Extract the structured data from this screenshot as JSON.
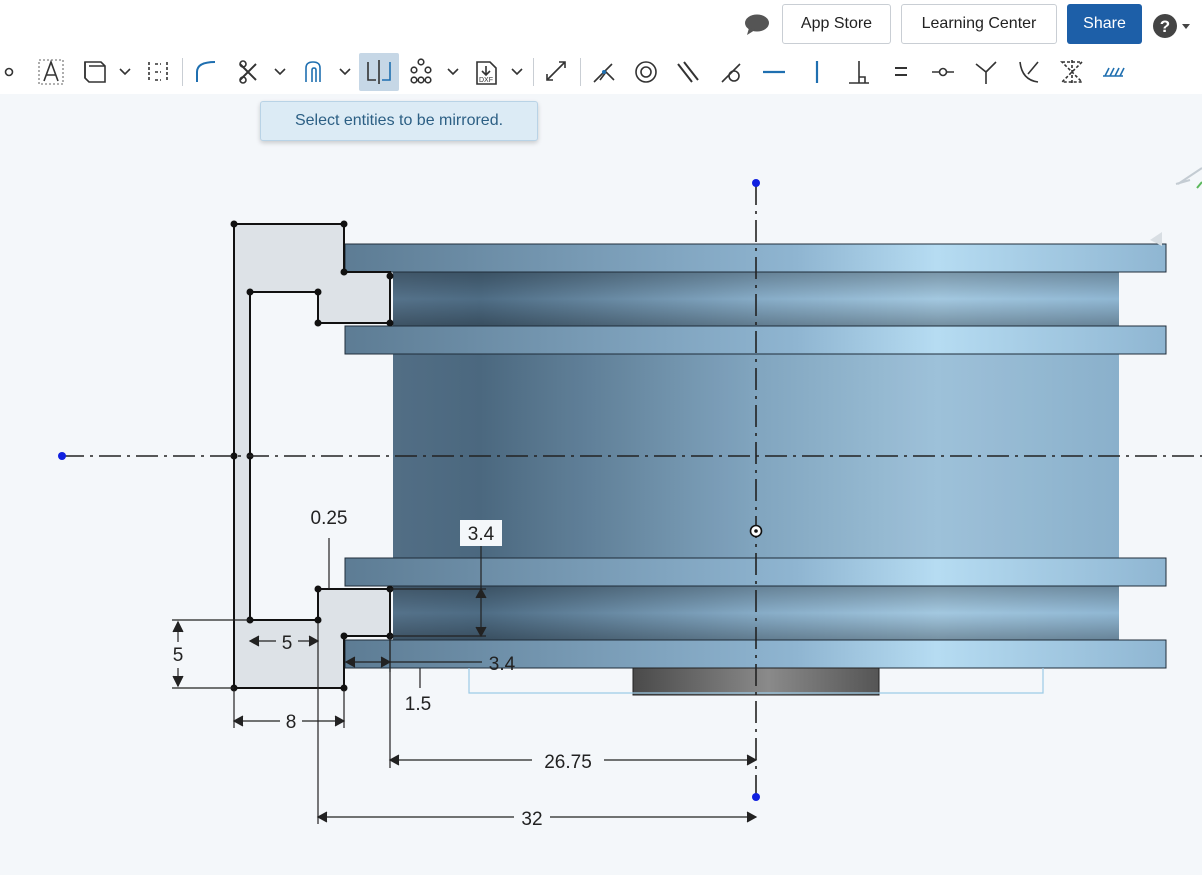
{
  "header": {
    "chat_icon": "chat-bubble-icon",
    "app_store_label": "App Store",
    "learning_center_label": "Learning Center",
    "share_label": "Share",
    "help_icon": "help-icon"
  },
  "toolbar": {
    "active_tool": "mirror",
    "tools": [
      "point",
      "text",
      "slot",
      "construction",
      "fillet",
      "trim",
      "offset",
      "mirror",
      "pattern",
      "dxf-insert",
      "transform",
      "coincident",
      "concentric",
      "parallel",
      "tangent",
      "horizontal",
      "vertical",
      "perpendicular",
      "equal",
      "midpoint",
      "normal",
      "curvature",
      "symmetric",
      "fix"
    ]
  },
  "tooltip": {
    "text": "Select entities to be mirrored."
  },
  "sketch": {
    "dimensions": {
      "d_0_25": "0.25",
      "d_3_4_vertical": "3.4",
      "d_3_4_horizontal": "3.4",
      "d_5_height": "5",
      "d_5_width": "5",
      "d_8": "8",
      "d_1_5": "1.5",
      "d_26_75": "26.75",
      "d_32": "32"
    }
  }
}
